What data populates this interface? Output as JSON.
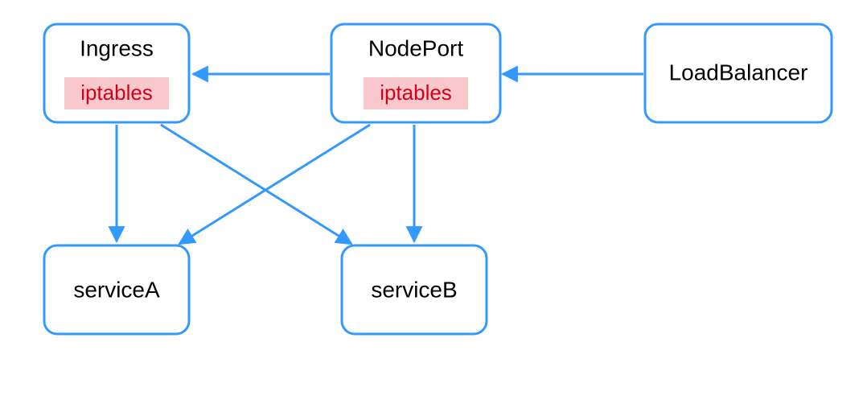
{
  "diagram": {
    "nodes": {
      "ingress": {
        "title": "Ingress",
        "tag": "iptables"
      },
      "nodeport": {
        "title": "NodePort",
        "tag": "iptables"
      },
      "loadbalancer": {
        "title": "LoadBalancer"
      },
      "serviceA": {
        "title": "serviceA"
      },
      "serviceB": {
        "title": "serviceB"
      }
    },
    "edges": [
      {
        "from": "loadbalancer",
        "to": "nodeport"
      },
      {
        "from": "nodeport",
        "to": "ingress"
      },
      {
        "from": "ingress",
        "to": "serviceA"
      },
      {
        "from": "ingress",
        "to": "serviceB"
      },
      {
        "from": "nodeport",
        "to": "serviceA"
      },
      {
        "from": "nodeport",
        "to": "serviceB"
      }
    ],
    "colors": {
      "stroke": "#3399ff",
      "tag_bg": "#f9c8cc",
      "tag_fg": "#d0021b"
    }
  }
}
